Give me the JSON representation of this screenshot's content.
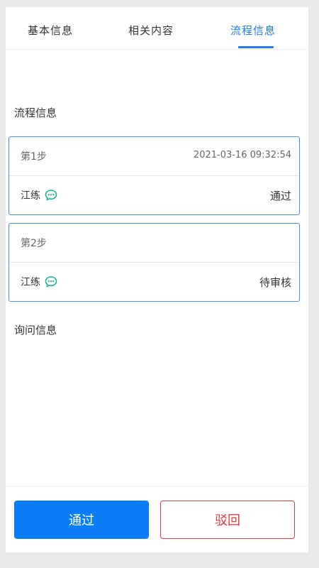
{
  "tabs": [
    {
      "label": "基本信息",
      "active": false
    },
    {
      "label": "相关内容",
      "active": false
    },
    {
      "label": "流程信息",
      "active": true
    }
  ],
  "process_section": {
    "title": "流程信息"
  },
  "steps": [
    {
      "name": "第1步",
      "time": "2021-03-16 09:32:54",
      "person": "江练",
      "status": "通过"
    },
    {
      "name": "第2步",
      "time": "",
      "person": "江练",
      "status": "待审核"
    }
  ],
  "inquiry_section": {
    "title": "询问信息"
  },
  "actions": {
    "approve_label": "通过",
    "reject_label": "驳回"
  },
  "colors": {
    "accent": "#1e7df0",
    "approve_button": "#0a7df5",
    "reject": "#e2383f",
    "chat_icon": "#19b394"
  },
  "icons": {
    "chat": "chat-bubble-icon"
  }
}
